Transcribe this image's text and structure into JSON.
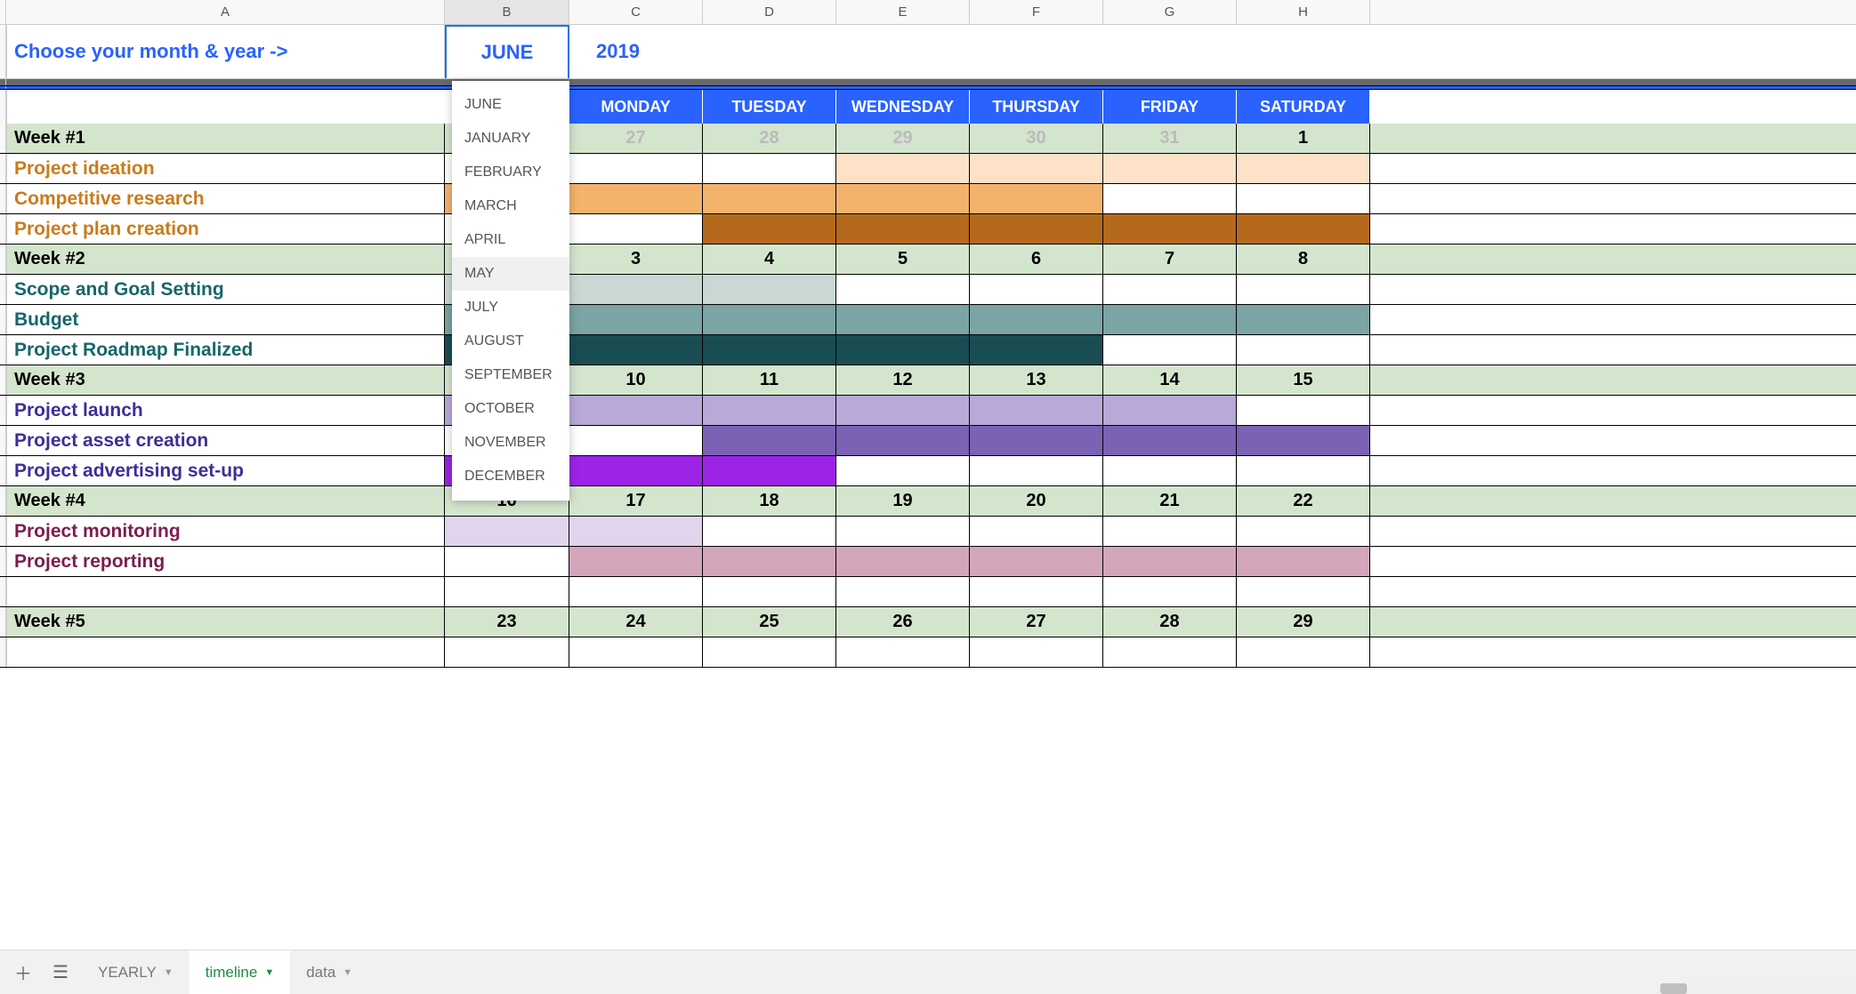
{
  "columns": [
    "A",
    "B",
    "C",
    "D",
    "E",
    "F",
    "G",
    "H"
  ],
  "prompt": "Choose your month & year ->",
  "month_selected": "JUNE",
  "year": "2019",
  "day_headers": [
    "MONDAY",
    "TUESDAY",
    "WEDNESDAY",
    "THURSDAY",
    "FRIDAY",
    "SATURDAY"
  ],
  "dropdown_options": [
    "JUNE",
    "JANUARY",
    "FEBRUARY",
    "MARCH",
    "APRIL",
    "MAY",
    "JULY",
    "AUGUST",
    "SEPTEMBER",
    "OCTOBER",
    "NOVEMBER",
    "DECEMBER"
  ],
  "dropdown_hover_index": 5,
  "weeks": [
    {
      "label": "Week #1",
      "dates": [
        "",
        "27",
        "28",
        "29",
        "30",
        "31",
        "1"
      ],
      "gray_indices": [
        1,
        2,
        3,
        4,
        5
      ],
      "tasks": [
        {
          "label": "Project ideation",
          "color": "t-orange",
          "fills": [
            "",
            "",
            "",
            "bg-peach-lt",
            "bg-peach-lt",
            "bg-peach-lt",
            "bg-peach-lt"
          ]
        },
        {
          "label": "Competitive research",
          "color": "t-orange",
          "fills": [
            "bg-peach-md",
            "bg-peach-md",
            "bg-peach-md",
            "bg-peach-md",
            "bg-peach-md",
            "",
            ""
          ]
        },
        {
          "label": "Project plan creation",
          "color": "t-orange",
          "fills": [
            "",
            "",
            "bg-brown",
            "bg-brown",
            "bg-brown",
            "bg-brown",
            "bg-brown"
          ]
        }
      ]
    },
    {
      "label": "Week #2",
      "dates": [
        "",
        "3",
        "4",
        "5",
        "6",
        "7",
        "8"
      ],
      "tasks": [
        {
          "label": "Scope and Goal Setting",
          "color": "t-teal",
          "fills": [
            "bg-teal-lt",
            "bg-teal-lt",
            "bg-teal-lt",
            "",
            "",
            "",
            ""
          ]
        },
        {
          "label": "Budget",
          "color": "t-teal",
          "fills": [
            "bg-teal-md",
            "bg-teal-md",
            "bg-teal-md",
            "bg-teal-md",
            "bg-teal-md",
            "bg-teal-md",
            "bg-teal-md"
          ]
        },
        {
          "label": "Project Roadmap Finalized",
          "color": "t-teal",
          "fills": [
            "bg-teal-dk",
            "bg-teal-dk",
            "bg-teal-dk",
            "bg-teal-dk",
            "bg-teal-dk",
            "",
            ""
          ]
        }
      ]
    },
    {
      "label": "Week #3",
      "dates": [
        "",
        "10",
        "11",
        "12",
        "13",
        "14",
        "15"
      ],
      "tasks": [
        {
          "label": "Project launch",
          "color": "t-purple",
          "fills": [
            "bg-lav-lt",
            "bg-lav-lt",
            "bg-lav-lt",
            "bg-lav-lt",
            "bg-lav-lt",
            "bg-lav-lt",
            ""
          ]
        },
        {
          "label": "Project asset creation",
          "color": "t-purple",
          "fills": [
            "",
            "",
            "bg-lav-md",
            "bg-lav-md",
            "bg-lav-md",
            "bg-lav-md",
            "bg-lav-md"
          ]
        },
        {
          "label": "Project advertising set-up",
          "color": "t-purple",
          "fills": [
            "bg-vio",
            "bg-vio",
            "bg-vio",
            "",
            "",
            "",
            ""
          ]
        }
      ]
    },
    {
      "label": "Week #4",
      "dates": [
        "16",
        "17",
        "18",
        "19",
        "20",
        "21",
        "22"
      ],
      "tasks": [
        {
          "label": "Project monitoring",
          "color": "t-maroon",
          "fills": [
            "bg-lav-vlt",
            "bg-lav-vlt",
            "",
            "",
            "",
            "",
            ""
          ]
        },
        {
          "label": "Project reporting",
          "color": "t-maroon",
          "fills": [
            "",
            "bg-pink",
            "bg-pink",
            "bg-pink",
            "bg-pink",
            "bg-pink",
            "bg-pink"
          ]
        },
        {
          "label": "",
          "color": "",
          "fills": [
            "",
            "",
            "",
            "",
            "",
            "",
            ""
          ]
        }
      ]
    },
    {
      "label": "Week #5",
      "dates": [
        "23",
        "24",
        "25",
        "26",
        "27",
        "28",
        "29"
      ],
      "tasks": [
        {
          "label": "",
          "color": "",
          "fills": [
            "",
            "",
            "",
            "",
            "",
            "",
            ""
          ]
        }
      ]
    }
  ],
  "tabs": [
    "YEARLY",
    "timeline",
    "data"
  ],
  "active_tab_index": 1
}
